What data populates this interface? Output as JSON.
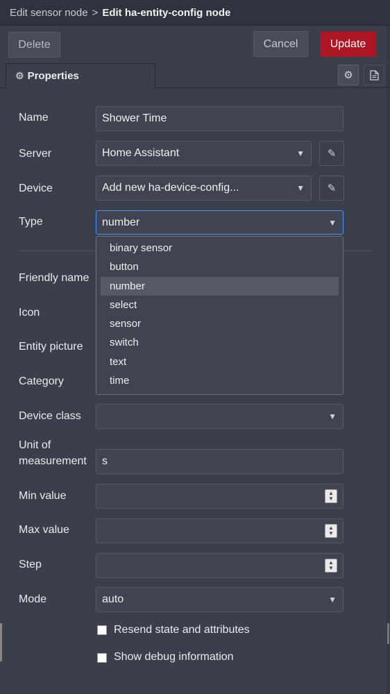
{
  "breadcrumb": {
    "parent": "Edit sensor node",
    "separator": ">",
    "current": "Edit ha-entity-config node"
  },
  "toolbar": {
    "delete_label": "Delete",
    "cancel_label": "Cancel",
    "update_label": "Update"
  },
  "tabs": {
    "properties_label": "Properties",
    "settings_icon": "gear-icon",
    "description_icon": "document-icon"
  },
  "form": {
    "name_label": "Name",
    "name_value": "Shower Time",
    "server_label": "Server",
    "server_value": "Home Assistant",
    "device_label": "Device",
    "device_value": "Add new ha-device-config...",
    "type_label": "Type",
    "type_value": "number",
    "friendly_name_label": "Friendly name",
    "icon_label": "Icon",
    "entity_picture_label": "Entity picture",
    "category_label": "Category",
    "device_class_label": "Device class",
    "device_class_value": "",
    "unit_label_1": "Unit of",
    "unit_label_2": "measurement",
    "unit_value": "s",
    "min_label": "Min value",
    "min_value": "",
    "max_label": "Max value",
    "max_value": "",
    "step_label": "Step",
    "step_value": "",
    "mode_label": "Mode",
    "mode_value": "auto",
    "resend_label": "Resend state and attributes",
    "debug_label": "Show debug information"
  },
  "type_options": [
    "binary sensor",
    "button",
    "number",
    "select",
    "sensor",
    "switch",
    "text",
    "time"
  ],
  "colors": {
    "background": "#3a3f4b",
    "update_button": "#ad1625",
    "focus_border": "#4d90fe"
  }
}
